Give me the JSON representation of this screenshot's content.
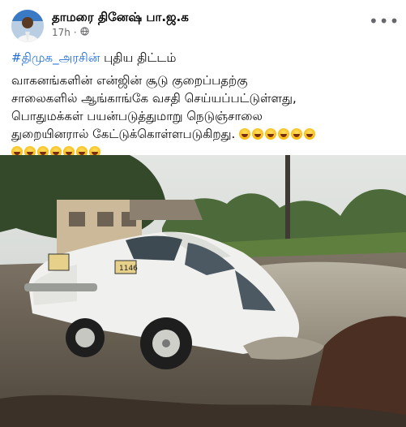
{
  "post": {
    "author": "தாமரை தினேஷ் பா.ஜ.க",
    "time": "17h",
    "hashtag": "#திமுக_அரசின்",
    "title_rest": "புதிய திட்டம்",
    "lines": [
      "வாகனங்களின் என்ஜின் சூடு குறைப்பதற்கு",
      "சாலைகளில் ஆங்காங்கே வசதி செய்யப்பட்டுள்ளது,",
      "பொதுமக்கள் பயன்படுத்துமாறு நெடுஞ்சாலை",
      "துறையினரால் கேட்டுக்கொள்ளபடுகிறது."
    ],
    "emoji_count_line4": 6,
    "emoji_count_line5": 7,
    "emoji_name": "laughing-tears-emoji"
  },
  "photo": {
    "car_plate": "1146"
  },
  "icons": {
    "globe": "globe-icon",
    "more": "more-options-icon"
  },
  "colors": {
    "hashtag": "#216fdb",
    "meta": "#65676b"
  }
}
